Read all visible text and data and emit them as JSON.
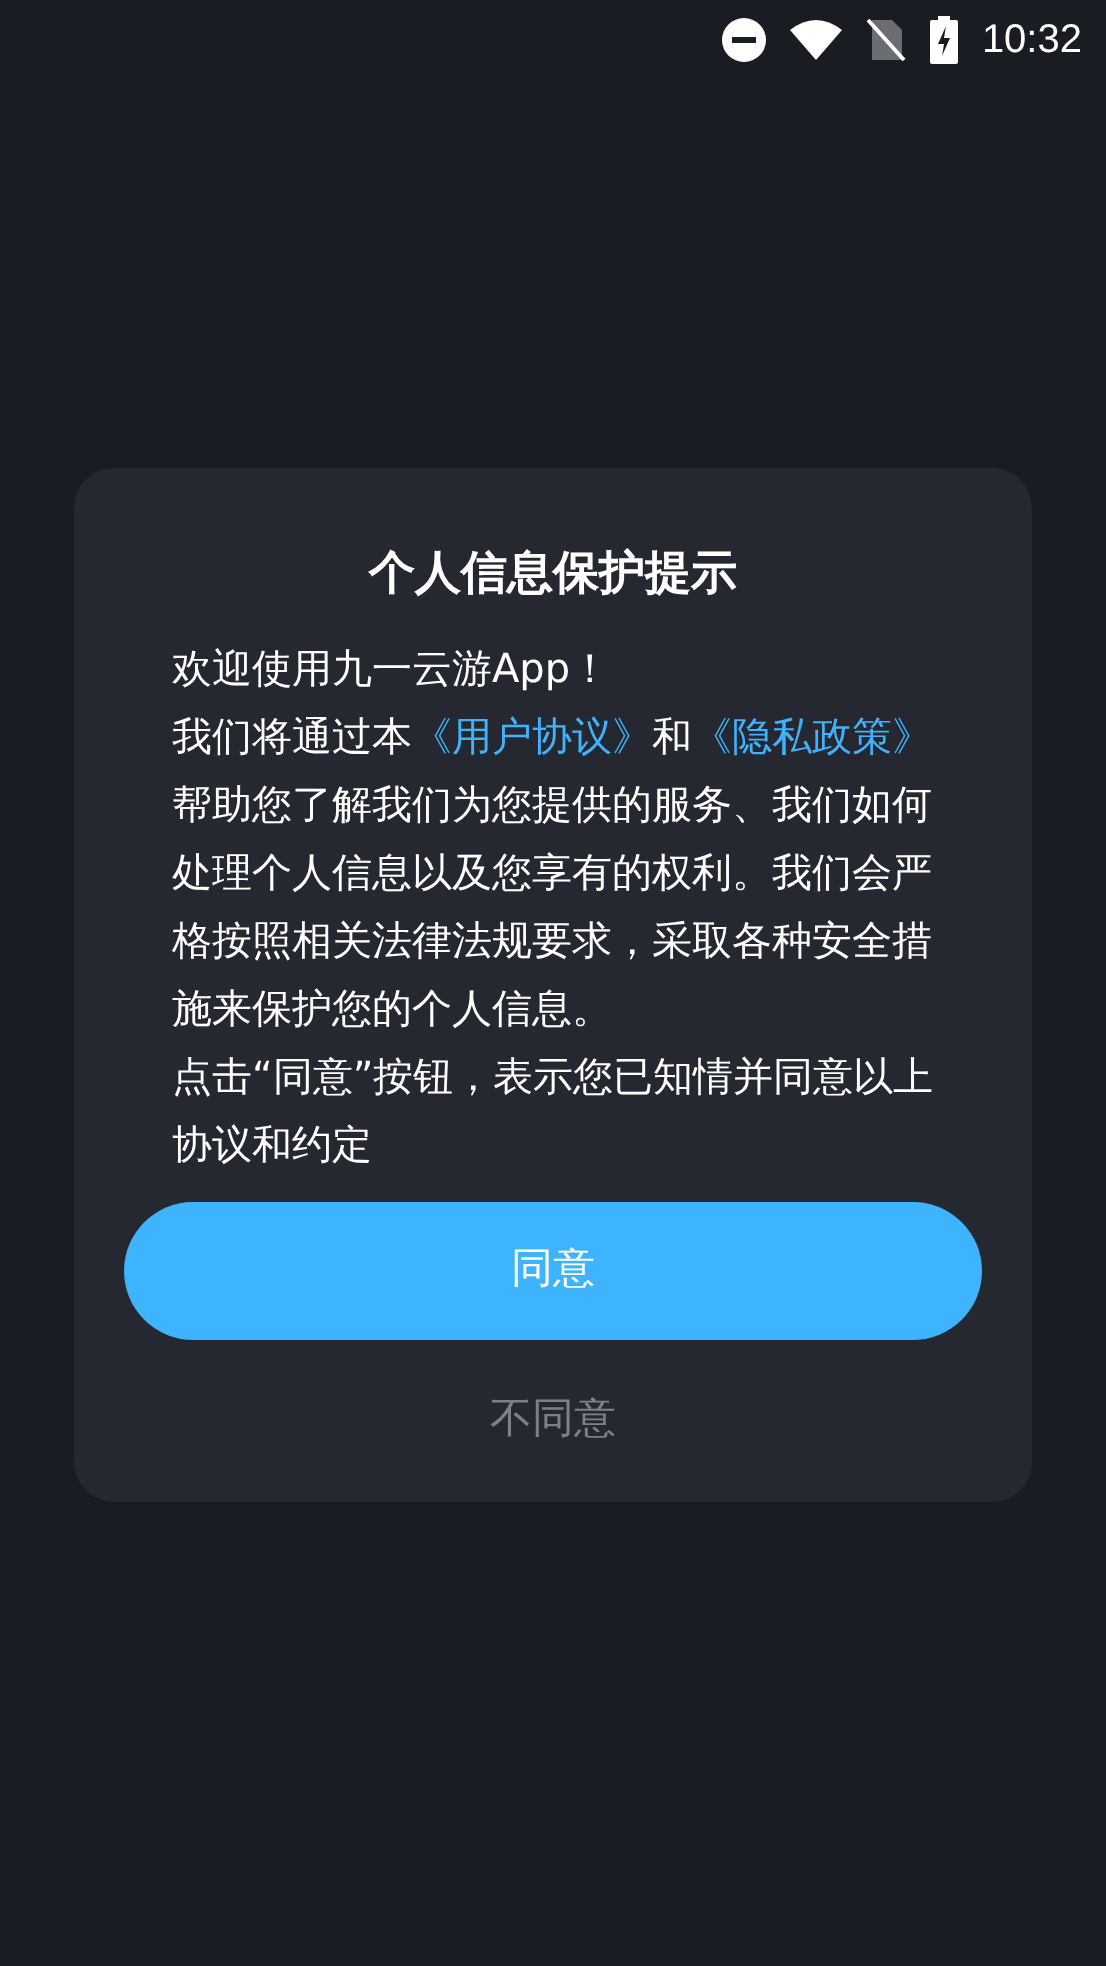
{
  "status_bar": {
    "time": "10:32"
  },
  "dialog": {
    "title": "个人信息保护提示",
    "paragraphs": [
      [
        {
          "kind": "text",
          "text": "欢迎使用九一云游App！"
        }
      ],
      [
        {
          "kind": "text",
          "text": "我们将通过本"
        },
        {
          "kind": "link",
          "text": "《用户协议》"
        },
        {
          "kind": "text",
          "text": "和"
        },
        {
          "kind": "link",
          "text": "《隐私政策》"
        },
        {
          "kind": "text",
          "text": "帮助您了解我们为您提供的服务、我们如何处理个人信息以及您享有的权利。我们会严格按照相关法律法规要求，采取各种安全措施来保护您的个人信息。"
        }
      ],
      [
        {
          "kind": "text",
          "text": "点击“同意”按钮，表示您已知情并同意以上协议和约定"
        }
      ]
    ],
    "buttons": [
      {
        "kind": "primary",
        "label": "同意"
      },
      {
        "kind": "plain",
        "label": "不同意"
      }
    ]
  }
}
